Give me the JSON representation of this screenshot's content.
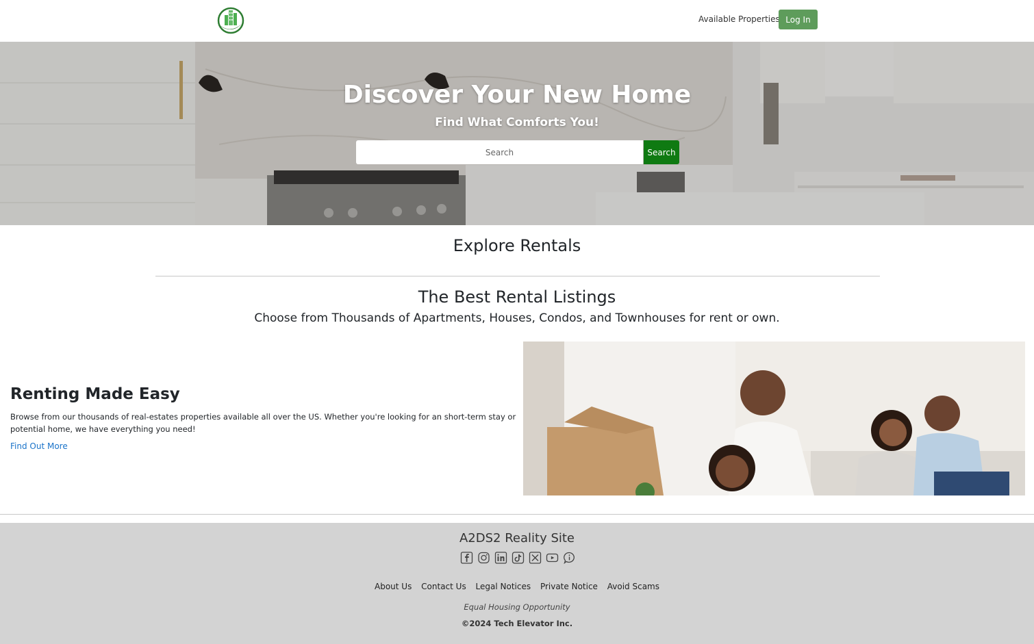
{
  "header": {
    "nav_available": "Available Properties",
    "login_label": "Log In"
  },
  "hero": {
    "title": "Discover Your New Home",
    "subtitle": "Find What Comforts You!",
    "search_placeholder": "Search",
    "search_button": "Search"
  },
  "main": {
    "explore_heading": "Explore Rentals",
    "best_heading": "The Best Rental Listings",
    "best_sub": "Choose from Thousands of Apartments, Houses, Condos, and Townhouses for rent or own.",
    "feature_title": "Renting Made Easy",
    "feature_desc": "Browse from our thousands of real-estates properties available all over the US. Whether you're looking for an short-term stay or potential home, we have everything you need!",
    "feature_link": "Find Out More"
  },
  "footer": {
    "site_name": "A2DS2 Reality Site",
    "social_icons": [
      "facebook-icon",
      "instagram-icon",
      "linkedin-icon",
      "tiktok-icon",
      "x-icon",
      "youtube-icon",
      "info-icon"
    ],
    "links": [
      "About Us",
      "Contact Us",
      "Legal Notices",
      "Private Notice",
      "Avoid Scams"
    ],
    "equal_housing": "Equal Housing Opportunity",
    "copyright": "©2024 Tech Elevator Inc."
  },
  "colors": {
    "login_bg": "#5e9c5b",
    "search_btn_bg": "#0f7a12",
    "link": "#1a73c9",
    "footer_bg": "#d3d3d3"
  }
}
